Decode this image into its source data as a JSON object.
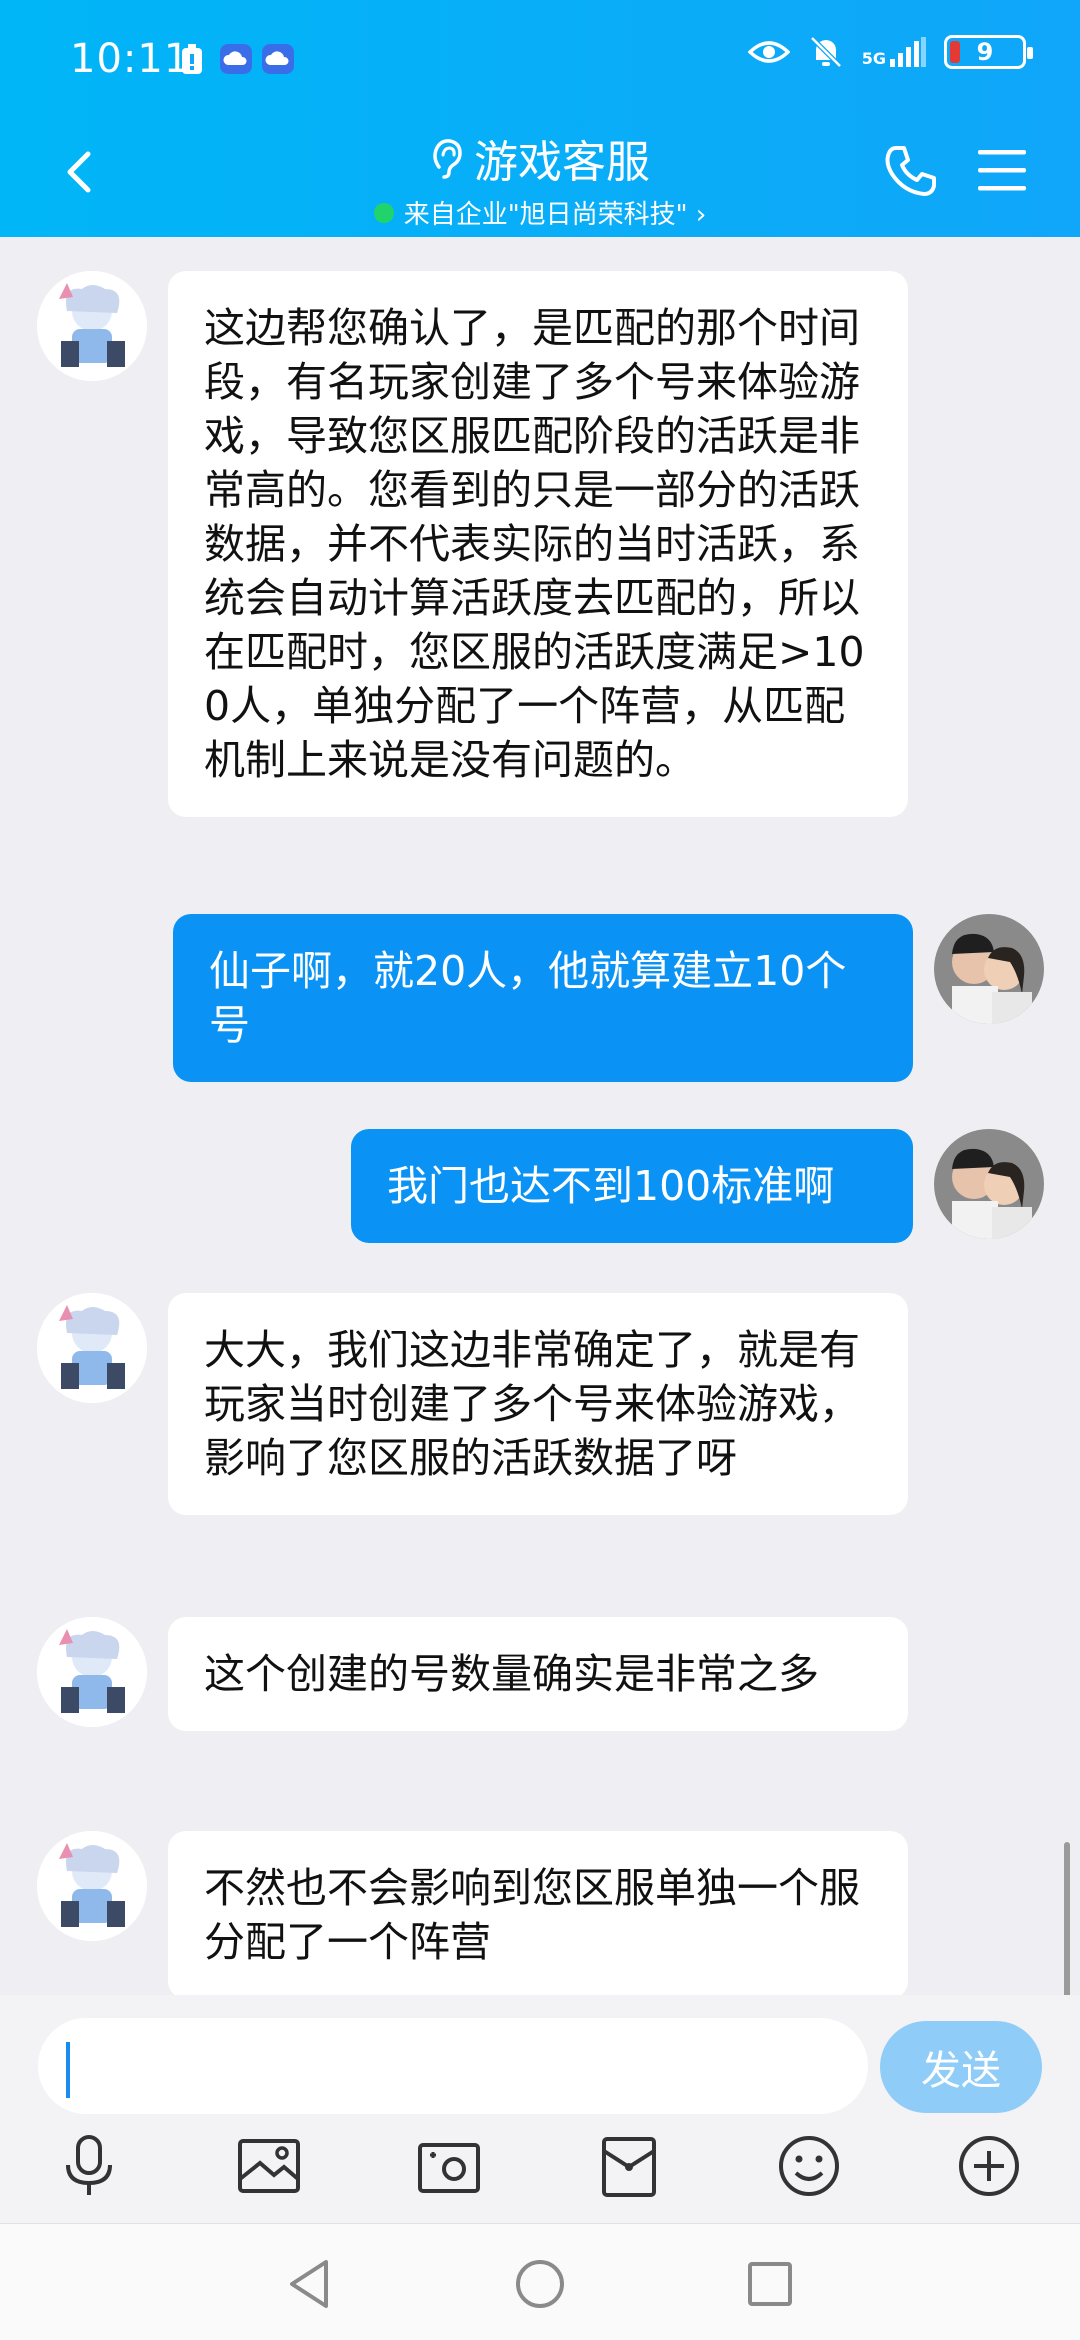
{
  "status_bar": {
    "time": "10:11",
    "network_label": "5G",
    "battery_level": "9"
  },
  "header": {
    "title": "游戏客服",
    "subtitle": "来自企业\"旭日尚荣科技\" ›"
  },
  "messages": [
    {
      "side": "left",
      "text": "这边帮您确认了，是匹配的那个时间段，有名玩家创建了多个号来体验游戏，导致您区服匹配阶段的活跃是非常高的。您看到的只是一部分的活跃数据，并不代表实际的当时活跃，系统会自动计算活跃度去匹配的，所以在匹配时，您区服的活跃度满足>100人，单独分配了一个阵营，从匹配机制上来说是没有问题的。"
    },
    {
      "side": "right",
      "text": "仙子啊，就20人，他就算建立10个号"
    },
    {
      "side": "right",
      "text": "我门也达不到100标准啊"
    },
    {
      "side": "left",
      "text": "大大，我们这边非常确定了，就是有玩家当时创建了多个号来体验游戏，影响了您区服的活跃数据了呀"
    },
    {
      "side": "left",
      "text": "这个创建的号数量确实是非常之多"
    },
    {
      "side": "left",
      "text": "不然也不会影响到您区服单独一个服分配了一个阵营"
    }
  ],
  "composer": {
    "input_value": "",
    "send_label": "发送"
  },
  "colors": {
    "header": "#0aaef8",
    "right_bubble": "#0a93f5",
    "left_bubble": "#ffffff",
    "send_button": "#8fcdf8"
  }
}
